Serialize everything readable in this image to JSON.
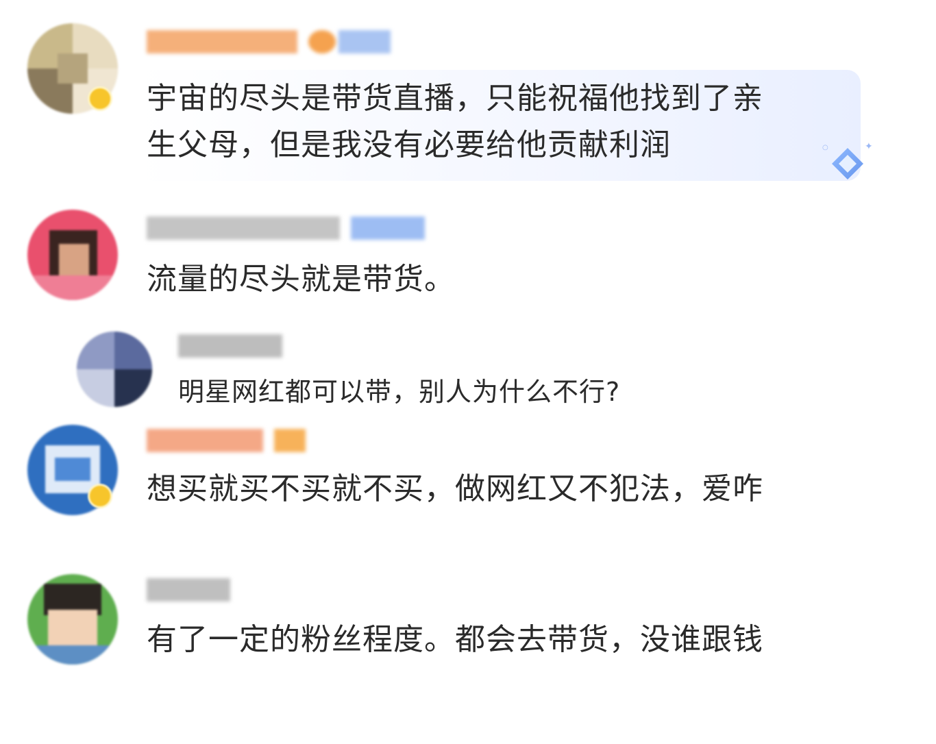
{
  "comments": [
    {
      "text": "宇宙的尽头是带货直播，只能祝福他找到了亲\n生父母，但是我没有必要给他贡献利润",
      "highlighted": true
    },
    {
      "text": "流量的尽头就是带货。"
    },
    {
      "text": "明星网红都可以带，别人为什么不行?",
      "is_reply": true
    },
    {
      "text": "想买就买不买就不买，做网红又不犯法，爱咋"
    },
    {
      "text": "有了一定的粉丝程度。都会去带货，没谁跟钱"
    }
  ],
  "icons": {
    "vip_badge": "vip-badge-icon",
    "highlight": "diamond-icon"
  },
  "colors": {
    "text": "#2a2a2a",
    "highlight_bg": "#e9efff",
    "vip_gold": "#f7c52b",
    "name_orange": "#f5a46a",
    "name_blue": "#8fb4f0",
    "name_gray": "#b8b8b8"
  }
}
